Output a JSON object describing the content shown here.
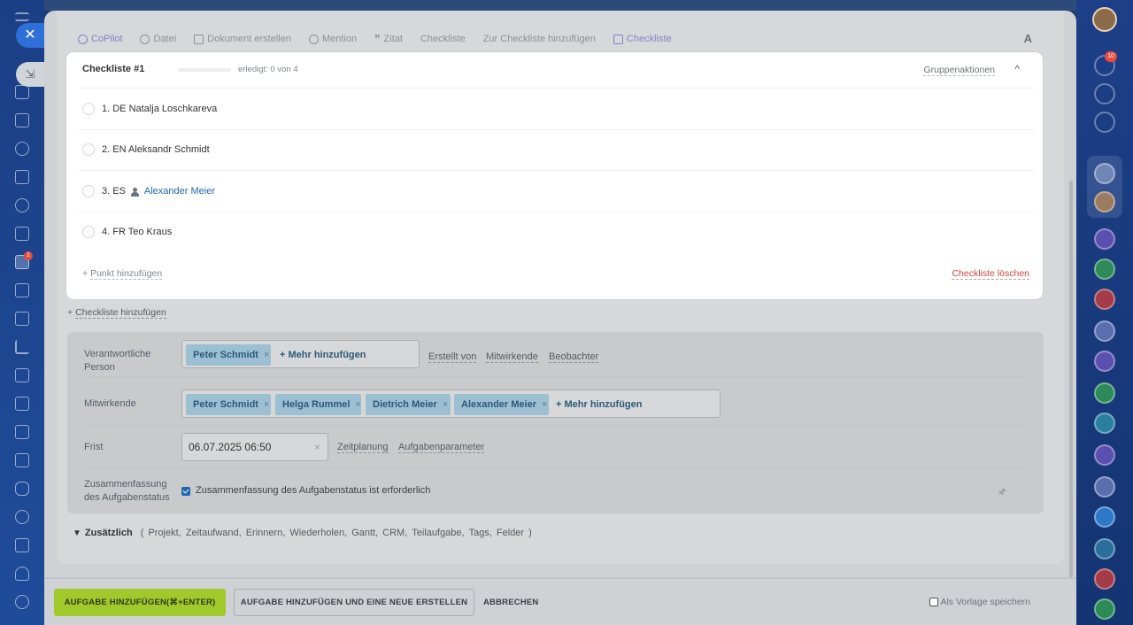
{
  "left_rail": {
    "close_symbol": "✕",
    "collapse_symbol": "⇲",
    "icons": [
      "menu-icon",
      "home-icon",
      "feed-icon",
      "chat-icon",
      "calendar-icon",
      "contacts-icon",
      "docs-icon",
      "tasks-icon",
      "card-icon",
      "chart-icon",
      "stats-icon",
      "cart-icon",
      "filter-icon",
      "screen-icon",
      "board-icon",
      "robot-icon",
      "target-icon",
      "signature-icon",
      "headset-icon",
      "settings-icon"
    ],
    "tasks_badge": "1"
  },
  "right_rail": {
    "notification_badge": "10"
  },
  "toolbar": {
    "items": [
      {
        "label": "CoPilot",
        "icon": "copilot-icon",
        "accent": true
      },
      {
        "label": "Datei",
        "icon": "paperclip-icon",
        "accent": false
      },
      {
        "label": "Dokument erstellen",
        "icon": "document-icon",
        "accent": false
      },
      {
        "label": "Mention",
        "icon": "at-icon",
        "accent": false
      },
      {
        "label": "Zitat",
        "icon": "quote-icon",
        "accent": false
      },
      {
        "label": "Checkliste",
        "icon": "",
        "accent": false
      },
      {
        "label": "Zur Checkliste hinzufügen",
        "icon": "",
        "accent": false
      },
      {
        "label": "Checkliste",
        "icon": "checklist-icon",
        "accent": true
      }
    ],
    "font_toggle": "A"
  },
  "checklist": {
    "title": "Checkliste #1",
    "progress_fraction": 0.0,
    "done_text": "erledigt: 0 von 4",
    "group_actions": "Gruppenaktionen",
    "collapse_symbol": "^",
    "items": [
      {
        "prefix": "1. DE Natalja Loschkareva",
        "link": ""
      },
      {
        "prefix": "2. EN Aleksandr Schmidt",
        "link": ""
      },
      {
        "prefix": "3. ES",
        "link": "Alexander Meier"
      },
      {
        "prefix": "4. FR Teo Kraus",
        "link": ""
      }
    ],
    "add_point_plus": "+",
    "add_point": "Punkt hinzufügen",
    "delete": "Checkliste löschen"
  },
  "add_checklist_plus": "+",
  "add_checklist": "Checkliste hinzufügen",
  "form": {
    "responsible": {
      "label": "Verantwortliche Person",
      "chips": [
        "Peter Schmidt"
      ],
      "more": "+ Mehr hinzufügen",
      "links": [
        "Erstellt von",
        "Mitwirkende",
        "Beobachter"
      ]
    },
    "participants": {
      "label": "Mitwirkende",
      "chips": [
        "Peter Schmidt",
        "Helga Rummel",
        "Dietrich Meier",
        "Alexander Meier"
      ],
      "more": "+ Mehr hinzufügen"
    },
    "deadline": {
      "label": "Frist",
      "value": "06.07.2025 06:50",
      "links": [
        "Zeitplanung",
        "Aufgabenparameter"
      ]
    },
    "summary": {
      "label": "Zusammenfassung des Aufgabenstatus",
      "checkbox_label": "Zusammenfassung des Aufgabenstatus ist erforderlich",
      "checked": true
    }
  },
  "extra": {
    "label": "Zusätzlich",
    "open": "(",
    "items": [
      "Projekt,",
      "Zeitaufwand,",
      "Erinnern,",
      "Wiederholen,",
      "Gantt,",
      "CRM,",
      "Teilaufgabe,",
      "Tags,",
      "Felder"
    ],
    "close": ")"
  },
  "footer": {
    "primary": "AUFGABE HINZUFÜGEN(⌘+ENTER)",
    "secondary": "AUFGABE HINZUFÜGEN UND EINE NEUE ERSTELLEN",
    "cancel": "ABBRECHEN",
    "save_template": "Als Vorlage speichern",
    "save_template_checked": false
  },
  "colors": {
    "primary_button": "#a1c92b",
    "link_blue": "#2067b0",
    "delete_red": "#d0443a",
    "accent_purple": "#8c7fc9",
    "chip_blue": "#9cbfd2"
  }
}
